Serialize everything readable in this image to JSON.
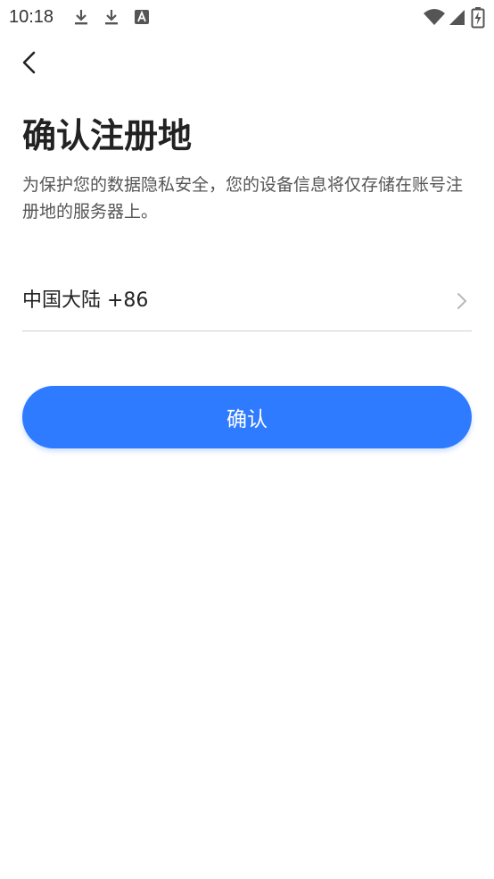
{
  "status_bar": {
    "time": "10:18",
    "icons": [
      "download-icon",
      "download-icon",
      "font-app-icon",
      "wifi-icon",
      "cellular-signal-icon",
      "battery-charging-icon"
    ]
  },
  "header": {
    "back_icon": "chevron-left-icon"
  },
  "main": {
    "title": "确认注册地",
    "description": "为保护您的数据隐私安全，您的设备信息将仅存储在账号注册地的服务器上。",
    "region": {
      "value": "中国大陆 +86",
      "icon": "chevron-right-icon"
    },
    "confirm_label": "确认"
  },
  "colors": {
    "accent": "#2f7bff",
    "title_text": "#222222",
    "secondary_text": "#555555",
    "divider": "#cfcfcf"
  }
}
